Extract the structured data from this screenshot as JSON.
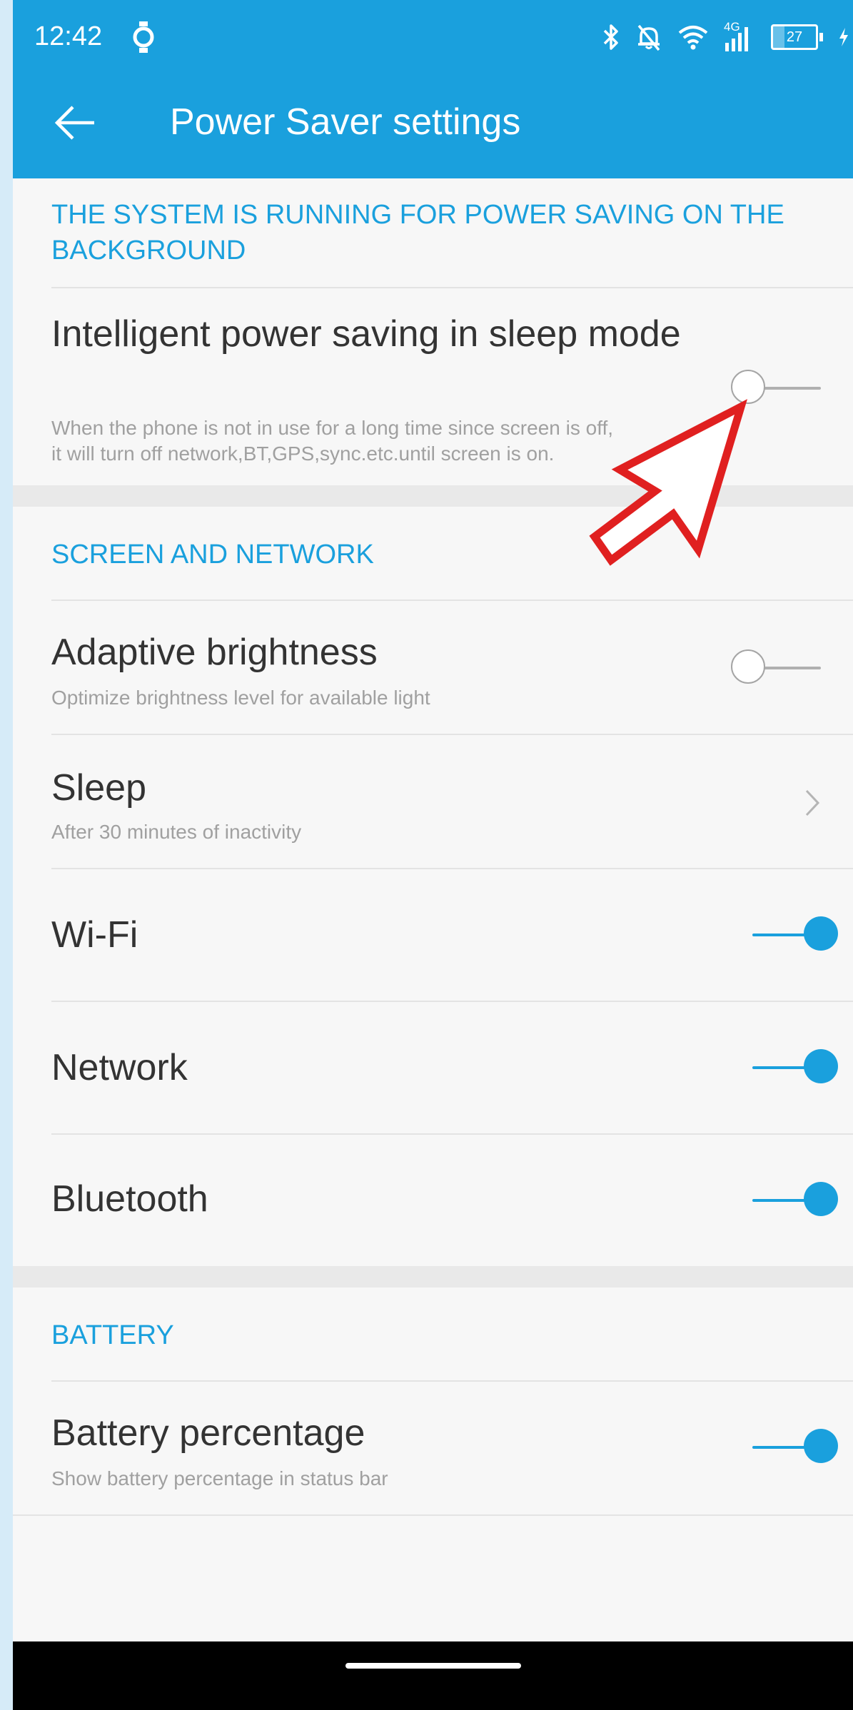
{
  "status_bar": {
    "time": "12:42",
    "battery_level": "27",
    "network_type": "4G",
    "icons": [
      "watch-icon",
      "bluetooth-icon",
      "mute-bell-icon",
      "wifi-icon",
      "signal-icon",
      "battery-icon",
      "charging-icon"
    ]
  },
  "header": {
    "title": "Power Saver settings",
    "back_icon": "arrow-left-icon",
    "color": "#1aa0dd"
  },
  "sections": {
    "background": {
      "header": "THE SYSTEM IS RUNNING FOR POWER SAVING ON THE BACKGROUND",
      "intelligent": {
        "title": "Intelligent power saving in sleep mode",
        "subtitle_line1": "When the phone is not in use for a long time since screen is off,",
        "subtitle_line2": "it will turn off network,BT,GPS,sync.etc.until screen is on.",
        "enabled": false
      }
    },
    "screen_network": {
      "header": "SCREEN AND NETWORK",
      "adaptive_brightness": {
        "title": "Adaptive brightness",
        "subtitle": "Optimize brightness level for available light",
        "enabled": false
      },
      "sleep": {
        "title": "Sleep",
        "subtitle": "After 30 minutes of inactivity"
      },
      "wifi": {
        "title": "Wi-Fi",
        "enabled": true
      },
      "network": {
        "title": "Network",
        "enabled": true
      },
      "bluetooth": {
        "title": "Bluetooth",
        "enabled": true
      }
    },
    "battery": {
      "header": "BATTERY",
      "battery_percentage": {
        "title": "Battery percentage",
        "subtitle": "Show battery percentage in status bar",
        "enabled": true
      }
    }
  },
  "annotation": {
    "type": "arrow-outline",
    "color": "#e02020"
  },
  "colors": {
    "accent": "#1aa0dd",
    "background": "#f7f7f7"
  }
}
